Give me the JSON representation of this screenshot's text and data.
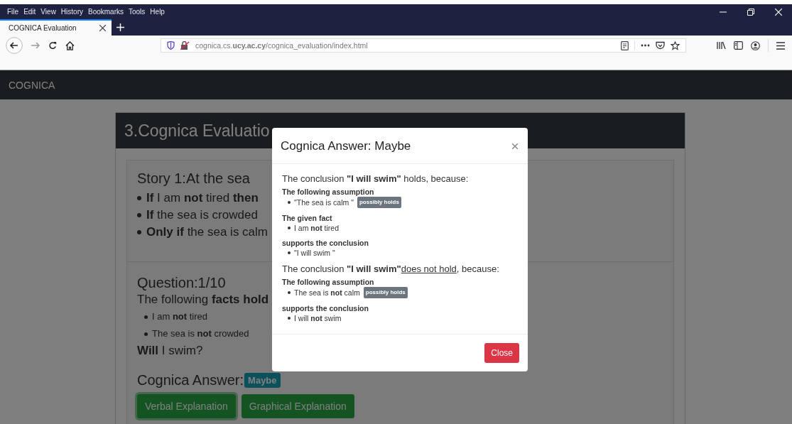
{
  "browser": {
    "menu": [
      "File",
      "Edit",
      "View",
      "History",
      "Bookmarks",
      "Tools",
      "Help"
    ],
    "tabs": [
      {
        "title": "COGNICA Evaluation",
        "selected": true
      }
    ],
    "url": "cognica.cs.**ucy.ac.cy**/cognica_evaluation/index.html"
  },
  "navbar": {
    "brand": "COGNICA"
  },
  "card": {
    "title": "3.Cognica Evaluatio",
    "story": {
      "title": "Story 1:At the sea",
      "rules": [
        "**If** I am **not** tired **then**",
        "**If** the sea is crowded",
        "**Only if** the sea is calm"
      ]
    },
    "question": {
      "title": "Question:1/10",
      "intro": "The following **facts hold**",
      "facts": [
        "I am **not** tired",
        "The sea is **not** crowded"
      ],
      "ask": "**Will** I swim?",
      "answer_label": "Cognica Answer:",
      "answer_badge": "Maybe",
      "buttons": [
        {
          "label": "Verbal Explanation",
          "selected": true
        },
        {
          "label": "Graphical Explanation",
          "selected": false
        }
      ]
    }
  },
  "modal": {
    "title": "Cognica Answer: Maybe",
    "sections": [
      {
        "heading": "The conclusion **\"I will swim\"** holds, because:",
        "groups": [
          {
            "label": "The following assumption",
            "items": [
              {
                "text": "\"The sea is calm \"",
                "badge": "possibly holds"
              }
            ]
          },
          {
            "label": "The given fact",
            "items": [
              {
                "text": "I am **not** tired"
              }
            ]
          },
          {
            "label": "supports the conclusion",
            "items": [
              {
                "text": "\"I will swim \""
              }
            ]
          }
        ]
      },
      {
        "heading": "The conclusion **\"I will swim\"**",
        "verdict": "does not hold",
        "tail": ", because:",
        "groups": [
          {
            "label": "The following assumption",
            "items": [
              {
                "text": "The sea is **not** calm",
                "badge": "possibly holds"
              }
            ]
          },
          {
            "label": "supports the conclusion",
            "items": [
              {
                "text": "I will **not** swim"
              }
            ]
          }
        ]
      }
    ],
    "close_button": "Close"
  }
}
